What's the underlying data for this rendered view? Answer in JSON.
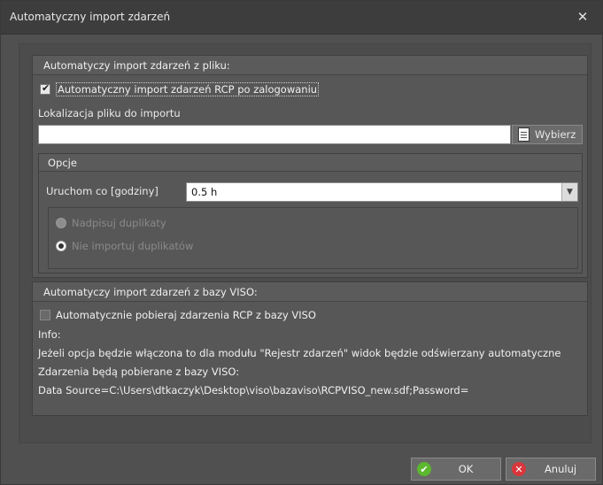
{
  "window": {
    "title": "Automatyczny import zdarzeń",
    "close_glyph": "✕"
  },
  "file_group": {
    "header": "Automatyczy import zdarzeń z pliku:",
    "auto_checkbox_label": "Automatyczny import zdarzeń RCP po zalogowaniu",
    "auto_checked": true,
    "location_label": "Lokalizacja pliku do importu",
    "location_value": "",
    "browse_label": "Wybierz",
    "options": {
      "header": "Opcje",
      "run_every_label": "Uruchom co [godziny]",
      "run_every_value": "0.5 h",
      "radio_overwrite": "Nadpisuj duplikaty",
      "radio_skip": "Nie importuj duplikatów",
      "selected": "skip"
    }
  },
  "viso_group": {
    "header": "Automatyczy import zdarzeń z bazy VISO:",
    "checkbox_label": "Automatycznie pobieraj zdarzenia RCP z bazy VISO",
    "checked": false,
    "info_lines": [
      "Info:",
      "Jeżeli opcja będzie włączona to dla modułu \"Rejestr zdarzeń\" widok będzie odświerzany automatyczne",
      "Zdarzenia będą pobierane z bazy VISO:",
      "Data Source=C:\\Users\\dtkaczyk\\Desktop\\viso\\bazaviso\\RCPVISO_new.sdf;Password="
    ]
  },
  "footer": {
    "ok_label": "OK",
    "cancel_label": "Anuluj"
  },
  "colors": {
    "ok_icon": "#5cb82e",
    "cancel_icon": "#d9363c"
  }
}
